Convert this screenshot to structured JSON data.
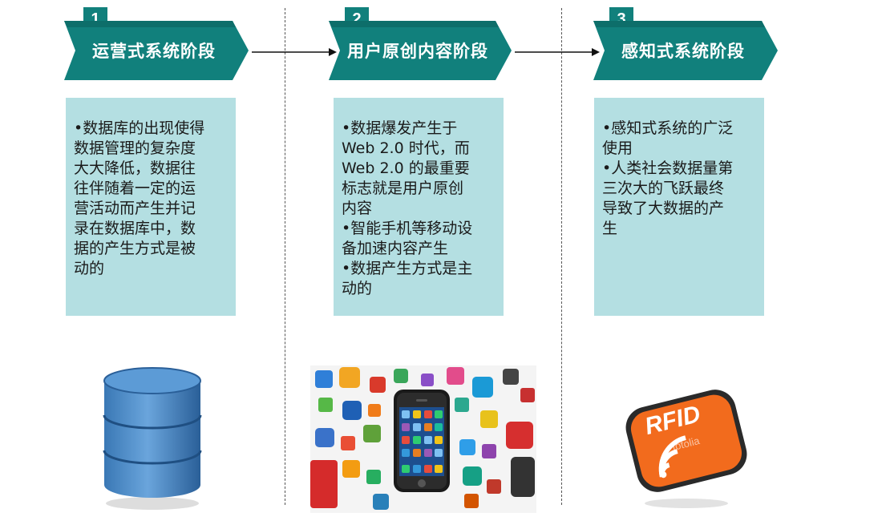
{
  "stages": [
    {
      "number": "1",
      "title": "运营式系统阶段",
      "lines": [
        "•数据库的出现使得",
        "数据管理的复杂度",
        "大大降低，数据往",
        "往伴随着一定的运",
        "营活动而产生并记",
        "录在数据库中，数",
        "据的产生方式是被",
        "动的"
      ]
    },
    {
      "number": "2",
      "title": "用户原创内容阶段",
      "lines": [
        "•数据爆发产生于",
        "Web 2.0 时代，而",
        "Web 2.0 的最重要",
        "标志就是用户原创",
        "内容",
        "•智能手机等移动设",
        "备加速内容产生",
        "•数据产生方式是主",
        "动的"
      ]
    },
    {
      "number": "3",
      "title": "感知式系统阶段",
      "lines": [
        "•感知式系统的广泛",
        "使用",
        "•人类社会数据量第",
        "三次大的飞跃最终",
        "导致了大数据的产",
        "生"
      ]
    }
  ],
  "rfid_label": "RFID",
  "watermark": "fotolia",
  "colors": {
    "teal": "#11807c",
    "light_teal": "#b4dfe2",
    "orange": "#f26b1d"
  }
}
